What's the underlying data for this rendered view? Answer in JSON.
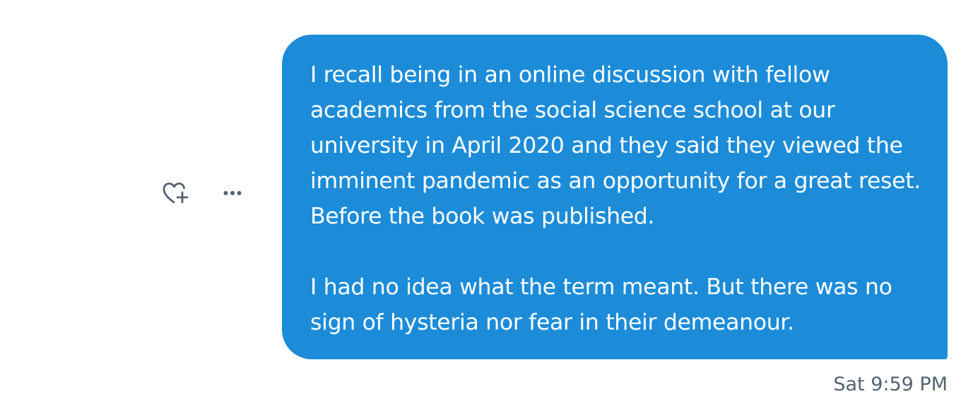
{
  "message": {
    "paragraphs": [
      "I recall being in an online discussion with fellow academics from the social science school at our university in April 2020 and they said they viewed the imminent pandemic as an opportunity for a great reset. Before the book was published.",
      "I had no idea what the term meant. But there was no sign of hysteria nor fear in their demeanour."
    ],
    "timestamp": "Sat 9:59 PM",
    "bubble_color": "#1d8cd8",
    "text_color": "#ffffff"
  },
  "actions": {
    "react_icon": "heart-plus-icon",
    "more_icon": "more-horizontal-icon",
    "icon_color": "#536471"
  }
}
